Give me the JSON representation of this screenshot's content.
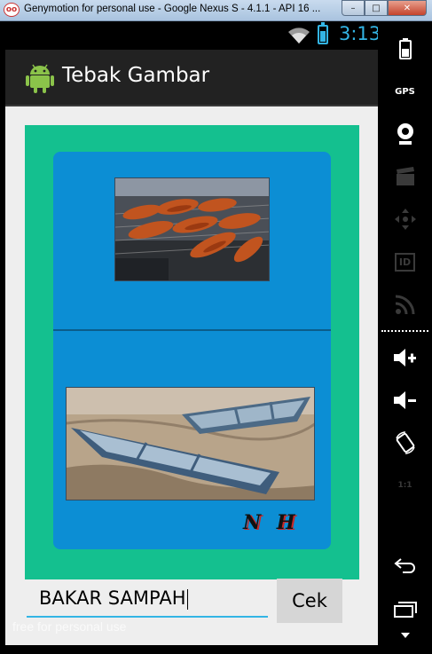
{
  "window": {
    "title": "Genymotion for personal use - Google Nexus S - 4.1.1 - API 16 ...",
    "icon_label": "oo",
    "minimize_symbol": "–",
    "maximize_symbol": "□",
    "close_symbol": "✕"
  },
  "status_bar": {
    "time": "3:13",
    "icons": [
      "wifi-icon",
      "battery-icon"
    ],
    "accent_color": "#33b5e5"
  },
  "action_bar": {
    "title": "Tebak Gambar",
    "icon": "android-logo"
  },
  "puzzle": {
    "top_image": "grilled-meat-photo",
    "bottom_image": "boats-on-sand-photo",
    "signature": "N H"
  },
  "answer": {
    "value": "BAKAR SAMPAH"
  },
  "check_button": {
    "label": "Cek"
  },
  "watermark": "free for personal use",
  "sidebar_tools": [
    "battery-icon",
    "gps-icon",
    "webcam-icon",
    "clapper-icon",
    "dpad-icon",
    "id-icon",
    "rss-icon",
    "volume-up-icon",
    "volume-down-icon",
    "rotate-icon",
    "scale-icon",
    "back-icon",
    "recent-apps-icon",
    "menu-icon"
  ],
  "sidebar_labels": {
    "gps": "GPS",
    "id": "ID",
    "scale": "1:1"
  },
  "colors": {
    "green_card": "#14c08f",
    "blue_card": "#0c8ed4",
    "action_bar": "#222222"
  }
}
